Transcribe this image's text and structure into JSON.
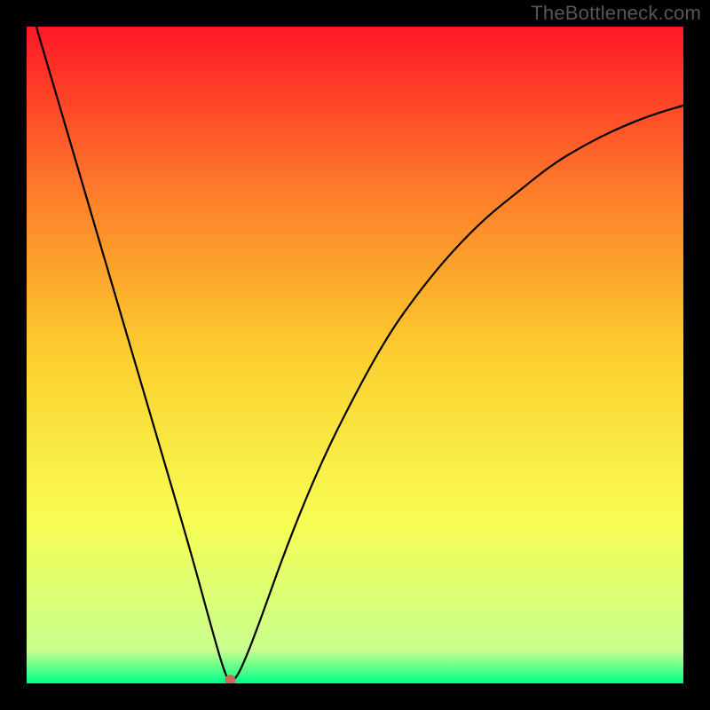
{
  "watermark": "TheBottleneck.com",
  "chart_data": {
    "type": "line",
    "title": "",
    "xlabel": "",
    "ylabel": "",
    "xlim": [
      0,
      100
    ],
    "ylim": [
      0,
      100
    ],
    "background": "rainbow-gradient",
    "gradient_stops": [
      {
        "frac": 0.0,
        "color": "#fe1727"
      },
      {
        "frac": 0.25,
        "color": "#fd7c2a"
      },
      {
        "frac": 0.5,
        "color": "#fbcf2f"
      },
      {
        "frac": 0.75,
        "color": "#f8fd53"
      },
      {
        "frac": 0.95,
        "color": "#c8ff8e"
      },
      {
        "frac": 1.0,
        "color": "#00ff88"
      }
    ],
    "series": [
      {
        "name": "bottleneck-curve",
        "color": "#000000",
        "x": [
          0,
          5,
          10,
          15,
          20,
          25,
          28,
          30,
          31,
          32,
          33,
          35,
          40,
          45,
          50,
          55,
          60,
          65,
          70,
          75,
          80,
          85,
          90,
          95,
          100
        ],
        "values": [
          105,
          88,
          71,
          54,
          37,
          20,
          9,
          2,
          0,
          1,
          3,
          8,
          22,
          34,
          44,
          53,
          60,
          66,
          71,
          75,
          79,
          82,
          84.5,
          86.5,
          88
        ]
      }
    ],
    "marker": {
      "x": 31,
      "y": 0.5,
      "color": "#c66a5a",
      "radius_px": 6
    }
  }
}
